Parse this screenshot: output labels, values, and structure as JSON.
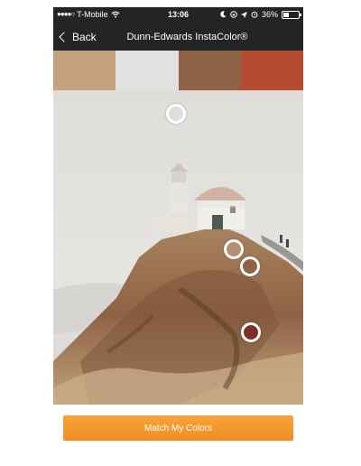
{
  "status_bar": {
    "signal_dots": "●●●●○",
    "carrier": "T-Mobile",
    "time": "13:06",
    "battery_percent": "36%",
    "battery_level": 0.36,
    "icons": [
      "wifi-icon",
      "moon-icon",
      "lock-rotation-icon",
      "location-arrow-icon",
      "alarm-icon"
    ]
  },
  "nav": {
    "back_label": "Back",
    "title": "Dunn-Edwards InstaColor®"
  },
  "swatches": {
    "colors": [
      "#c5a27f",
      "#e1e1e0",
      "#8e6345",
      "#b54c32"
    ]
  },
  "photo": {
    "picker_colors": [
      "#dedede",
      "#b48f73",
      "#8e6345",
      "#7a3022"
    ]
  },
  "actions": {
    "match_label": "Match My Colors",
    "accent_color": "#f39a2f"
  }
}
